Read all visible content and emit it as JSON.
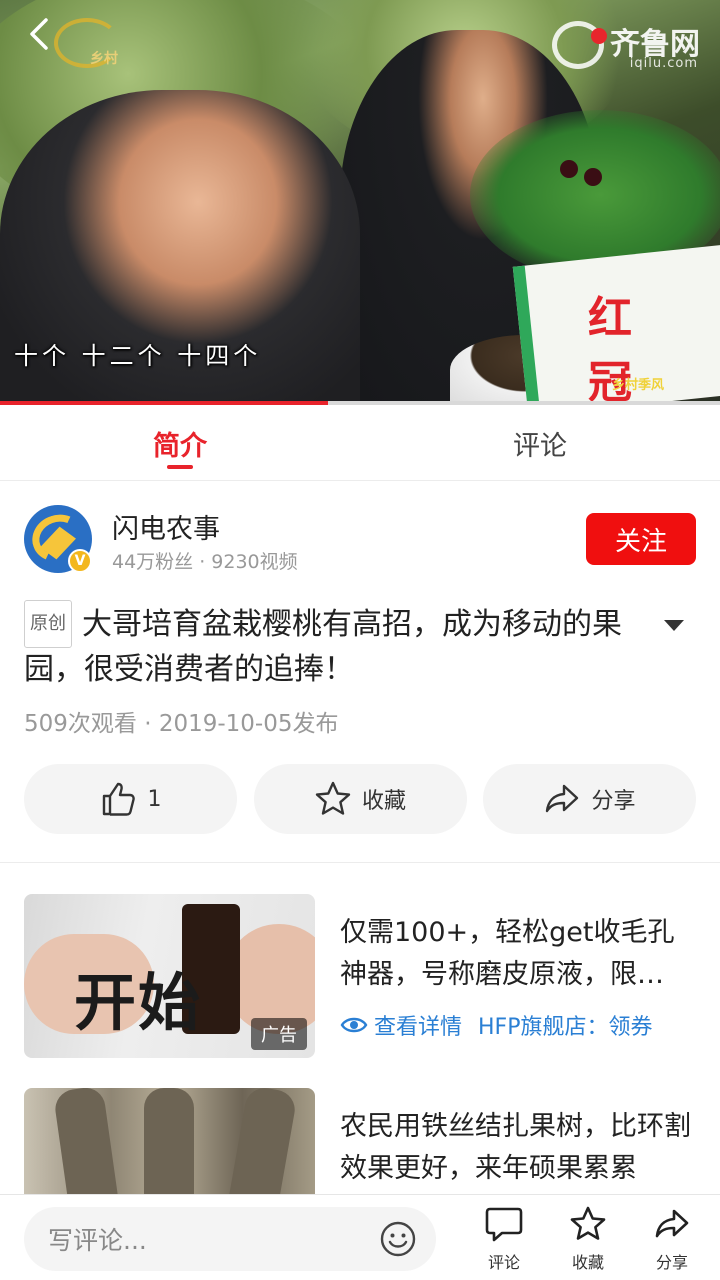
{
  "video": {
    "subtitle": "十个  十二个  十四个",
    "watermark": "齐鲁网",
    "watermark_url": "iqilu.com",
    "channel_logo_text": "乡村",
    "corner_brand": "乡村季风",
    "sign_text": "红 冠",
    "progress": 0.455
  },
  "tabs": [
    {
      "label": "简介",
      "active": true
    },
    {
      "label": "评论",
      "active": false
    }
  ],
  "author": {
    "name": "闪电农事",
    "meta": "44万粉丝 · 9230视频",
    "verified_badge": "V",
    "follow_label": "关注"
  },
  "post": {
    "badge": "原创",
    "title": "大哥培育盆栽樱桃有高招，成为移动的果园，很受消费者的追捧！",
    "meta": "509次观看 · 2019-10-05发布"
  },
  "actions": [
    {
      "icon": "thumbs-up-icon",
      "label": "1"
    },
    {
      "icon": "star-icon",
      "label": "收藏"
    },
    {
      "icon": "share-icon",
      "label": "分享"
    }
  ],
  "feed": [
    {
      "title": "仅需100+，轻松get收毛孔神器，号称磨皮原液，限…",
      "thumb_text": "开始",
      "ad_tag": "广告",
      "ad_link": "查看详情",
      "ad_shop": "HFP旗舰店：领券"
    },
    {
      "title": "农民用铁丝结扎果树，比环割效果更好，来年硕果累累"
    }
  ],
  "bottom_bar": {
    "comment_placeholder": "写评论...",
    "buttons": [
      {
        "icon": "comment-icon",
        "label": "评论"
      },
      {
        "icon": "star-icon",
        "label": "收藏"
      },
      {
        "icon": "share-icon",
        "label": "分享"
      }
    ]
  },
  "colors": {
    "accent": "#e8232b",
    "follow": "#f00f0f",
    "link": "#2a7fd4"
  }
}
